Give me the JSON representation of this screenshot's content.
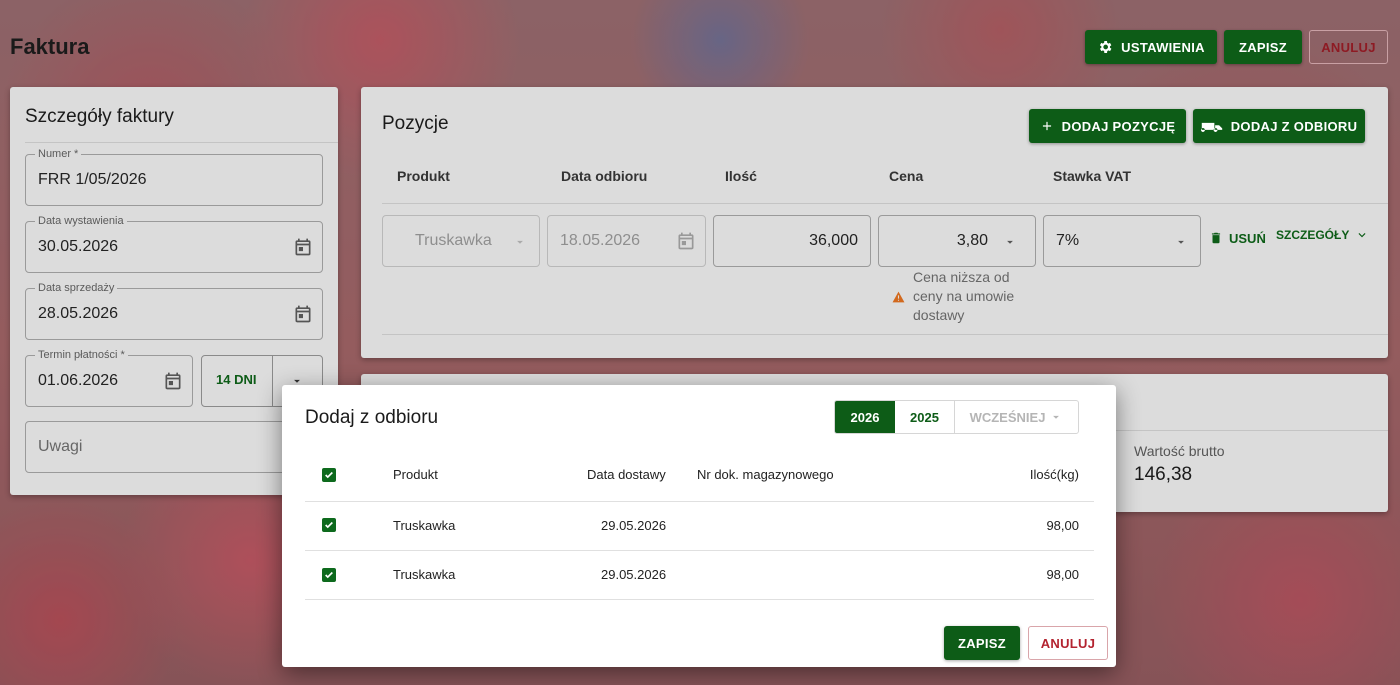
{
  "header": {
    "title": "Faktura",
    "settings_label": "USTAWIENIA",
    "save_label": "ZAPISZ",
    "cancel_label": "ANULUJ"
  },
  "details": {
    "title": "Szczegóły faktury",
    "number_label": "Numer *",
    "number_value": "FRR 1/05/2026",
    "issue_date_label": "Data wystawienia",
    "issue_date_value": "30.05.2026",
    "sale_date_label": "Data sprzedaży",
    "sale_date_value": "28.05.2026",
    "due_label": "Termin płatności *",
    "due_value": "01.06.2026",
    "due_days": "14 DNI",
    "notes_label": "Uwagi"
  },
  "positions": {
    "title": "Pozycje",
    "add_position_label": "DODAJ POZYCJĘ",
    "add_from_pickup_label": "DODAJ Z ODBIORU",
    "columns": [
      "Produkt",
      "Data odbioru",
      "Ilość",
      "Cena",
      "Stawka VAT"
    ],
    "row": {
      "product": "Truskawka",
      "pickup_date": "18.05.2026",
      "quantity": "36,000",
      "price": "3,80",
      "vat": "7%",
      "delete_label": "USUŃ",
      "details_label": "SZCZEGÓŁY",
      "price_warning": "Cena niższa od ceny na umowie dostawy"
    }
  },
  "summary": {
    "gross_label": "Wartość brutto",
    "gross_value": "146,38"
  },
  "modal": {
    "title": "Dodaj z odbioru",
    "year_tabs": [
      "2026",
      "2025",
      "WCZEŚNIEJ"
    ],
    "columns": [
      "Produkt",
      "Data dostawy",
      "Nr dok. magazynowego",
      "Ilość(kg)"
    ],
    "rows": [
      {
        "product": "Truskawka",
        "date": "29.05.2026",
        "doc": "",
        "qty": "98,00"
      },
      {
        "product": "Truskawka",
        "date": "29.05.2026",
        "doc": "",
        "qty": "98,00"
      }
    ],
    "save_label": "ZAPISZ",
    "cancel_label": "ANULUJ"
  },
  "colors": {
    "primary": "#0d5c17",
    "danger": "#b3232f",
    "warning": "#d2691e"
  }
}
